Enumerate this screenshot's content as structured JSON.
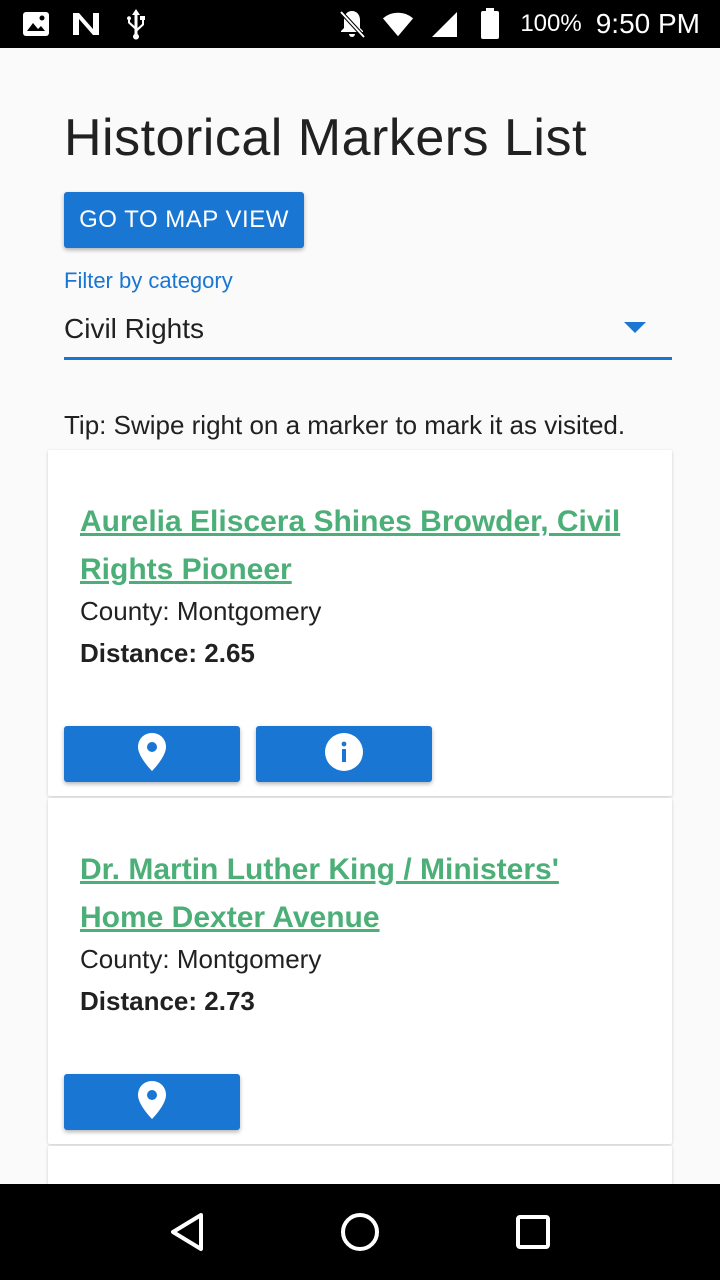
{
  "status_bar": {
    "battery_percent": "100%",
    "time": "9:50 PM",
    "icons": [
      "image-icon",
      "n-icon",
      "usb-icon",
      "bell-off-icon",
      "wifi-icon",
      "signal-icon",
      "battery-icon"
    ]
  },
  "page": {
    "title": "Historical Markers List",
    "map_button_label": "GO TO MAP VIEW",
    "filter_label": "Filter by category",
    "filter_value": "Civil Rights",
    "tip": "Tip: Swipe right on a marker to mark it as visited."
  },
  "markers": [
    {
      "name": "Aurelia Eliscera Shines Browder, Civil Rights Pioneer",
      "county": "County: Montgomery",
      "distance": "Distance: 2.65",
      "actions": [
        "map-pin-icon",
        "info-icon"
      ]
    },
    {
      "name": "Dr. Martin Luther King / Ministers' Home Dexter Avenue",
      "county": "County: Montgomery",
      "distance": "Distance: 2.73",
      "actions": [
        "map-pin-icon"
      ]
    }
  ],
  "colors": {
    "primary": "#1976d2",
    "link": "#4caf78",
    "text": "#212121",
    "background": "#fafafa"
  },
  "nav_bar": {
    "icons": [
      "back-icon",
      "home-icon",
      "recents-icon"
    ]
  }
}
